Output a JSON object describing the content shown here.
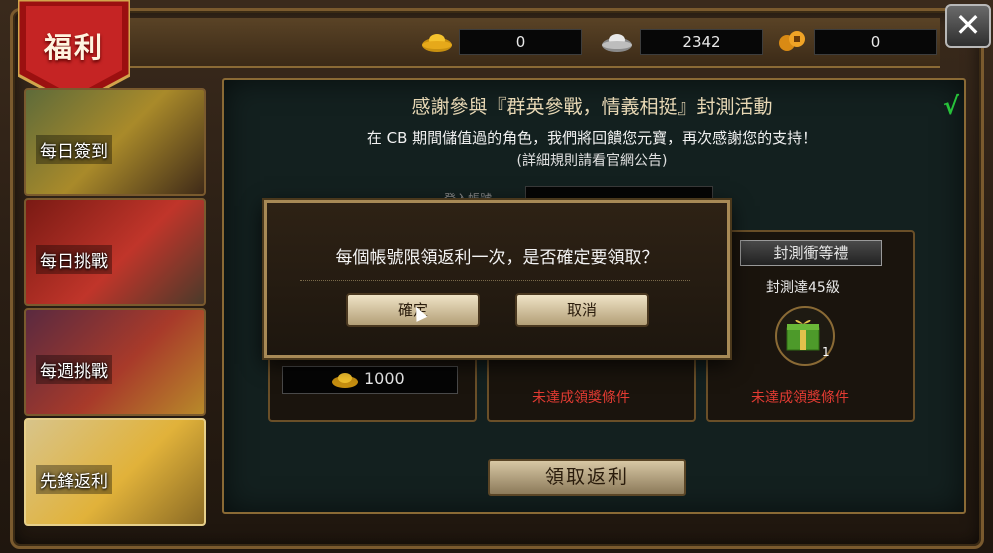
{
  "window": {
    "title": "福利",
    "close_icon": "close-icon"
  },
  "resources": {
    "gold": {
      "icon": "gold-ingot-icon",
      "value": "0"
    },
    "silver": {
      "icon": "silver-ingot-icon",
      "value": "2342"
    },
    "coin": {
      "icon": "coins-icon",
      "value": "0"
    }
  },
  "sidebar": {
    "items": [
      {
        "label": "每日簽到"
      },
      {
        "label": "每日挑戰"
      },
      {
        "label": "每週挑戰"
      },
      {
        "label": "先鋒返利"
      }
    ]
  },
  "panel": {
    "title": "感謝參與『群英參戰，情義相挺』封測活動",
    "subtitle": "在 CB 期間儲值過的角色，我們將回饋您元寶，再次感謝您的支持！",
    "note": "(詳細規則請看官網公告)",
    "login_label": "登入帳號",
    "amount": "1000",
    "middle_status": "未達成領獎條件",
    "right_card": {
      "title": "封測衝等禮",
      "requirement": "封測達45級",
      "status": "未達成領獎條件",
      "count": "1"
    },
    "claim_button": "領取返利"
  },
  "dialog": {
    "message": "每個帳號限領返利一次，是否確定要領取？",
    "confirm": "確定",
    "cancel": "取消"
  },
  "colors": {
    "accent_gold": "#a88a56",
    "status_red": "#e23b32",
    "check_green": "#27c23a"
  }
}
